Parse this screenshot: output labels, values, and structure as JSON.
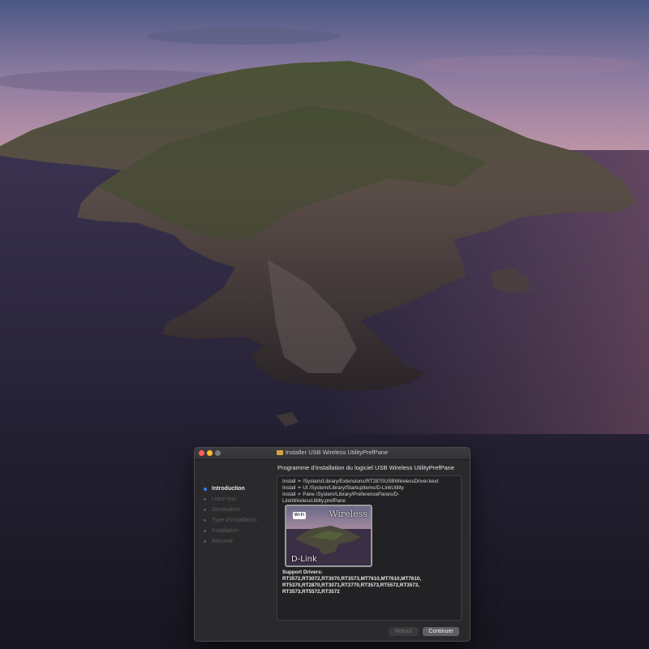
{
  "window": {
    "title": "Installer USB Wireless UtilityPrefPane"
  },
  "sidebar": {
    "steps": [
      {
        "label": "Introduction",
        "active": true
      },
      {
        "label": "Lisez-moi",
        "active": false
      },
      {
        "label": "Destination",
        "active": false
      },
      {
        "label": "Type d’installation",
        "active": false
      },
      {
        "label": "Installation",
        "active": false
      },
      {
        "label": "Résumé",
        "active": false
      }
    ]
  },
  "main": {
    "heading": "Programme d’installation du logiciel USB Wireless UtilityPrefPane",
    "install_lines": [
      "Install  ➣ /System/Library/Extensions/RT2870USBWirelessDriver.kext",
      "Install  ➣ UI  /System/Library/StartupItems/D-LinkUtility",
      "Install  ➣ Pane /System/Library/PreferencePanes/D-",
      "LinkWirelessUtility.prefPane"
    ],
    "logo": {
      "wireless_text": "Wireless",
      "brand_text": "D-Link",
      "badge_text": "Wi-Fi"
    },
    "support_title": "Support Drivers:",
    "support_lines": [
      "RT3572,RT3072,RT3070,RT3573,MT7610,MT7610,MT7610,",
      "RT5370,RT2870,RT3071,RT2770,RT3573,RT5572,RT3573,",
      "RT3573,RT5572,RT3572"
    ]
  },
  "buttons": {
    "back_label": "Retour",
    "continue_label": "Continuer"
  }
}
